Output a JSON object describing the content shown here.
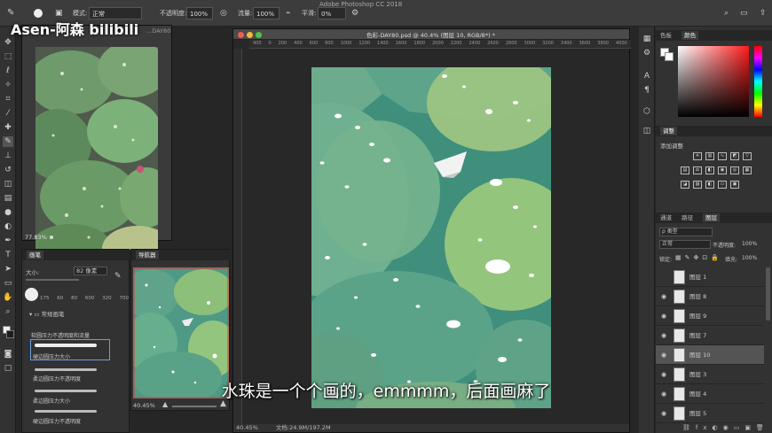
{
  "app_title": "Adobe Photoshop CC 2018",
  "watermark": "Asen-阿森 bilibili",
  "options_bar": {
    "mode_label": "模式:",
    "mode_value": "正常",
    "opacity_label": "不透明度:",
    "opacity_value": "100%",
    "flow_label": "流量:",
    "flow_value": "100%",
    "smoothing_label": "平滑:",
    "smoothing_value": "0%"
  },
  "reference_window": {
    "zoom": "77.83%",
    "caption": "...DAY80"
  },
  "brush_panel": {
    "tab": "画笔",
    "size_label": "大小:",
    "size_value": "82 像素",
    "preset_sizes": [
      "175",
      "60",
      "80",
      "600",
      "320",
      "700"
    ],
    "group_label": "常规画笔",
    "brushes": [
      "软圆压力不透明度和流量",
      "硬边圆压力大小",
      "柔边圆压力不透明度",
      "柔边圆压力大小",
      "硬边圆压力不透明度"
    ]
  },
  "navigator_panel": {
    "tab": "导航器",
    "zoom": "40.45%"
  },
  "document": {
    "title": "色彩-DAY80.psd @ 40.4% (图层 10, RGB/8*) *",
    "ruler_marks": [
      "400",
      "0",
      "200",
      "400",
      "600",
      "800",
      "1000",
      "1200",
      "1400",
      "1600",
      "1800",
      "2000",
      "2200",
      "2400",
      "2600",
      "2800",
      "3000",
      "3200",
      "3400",
      "3600",
      "3800",
      "4000"
    ],
    "zoom": "40.45%",
    "doc_info": "文档:24.9M/197.2M"
  },
  "color_panel": {
    "tabs": [
      "色板",
      "颜色"
    ]
  },
  "adjustments_panel": {
    "tab": "调整",
    "subtitle": "添加调整"
  },
  "layers_panel": {
    "tabs": [
      "通道",
      "路径",
      "图层"
    ],
    "filter_label": "ρ 类型",
    "blend_mode": "正常",
    "opacity_label": "不透明度:",
    "opacity_value": "100%",
    "lock_label": "锁定:",
    "fill_label": "填充:",
    "fill_value": "100%",
    "layers": [
      {
        "name": "图层 1",
        "visible": false,
        "selected": false
      },
      {
        "name": "图层 8",
        "visible": true,
        "selected": false
      },
      {
        "name": "图层 9",
        "visible": true,
        "selected": false
      },
      {
        "name": "图层 7",
        "visible": true,
        "selected": false
      },
      {
        "name": "图层 10",
        "visible": true,
        "selected": true
      },
      {
        "name": "图层 3",
        "visible": true,
        "selected": false
      },
      {
        "name": "图层 4",
        "visible": true,
        "selected": false
      },
      {
        "name": "图层 5",
        "visible": true,
        "selected": false
      }
    ]
  },
  "subtitle": "水珠是一个个画的，emmmm，后面画麻了"
}
